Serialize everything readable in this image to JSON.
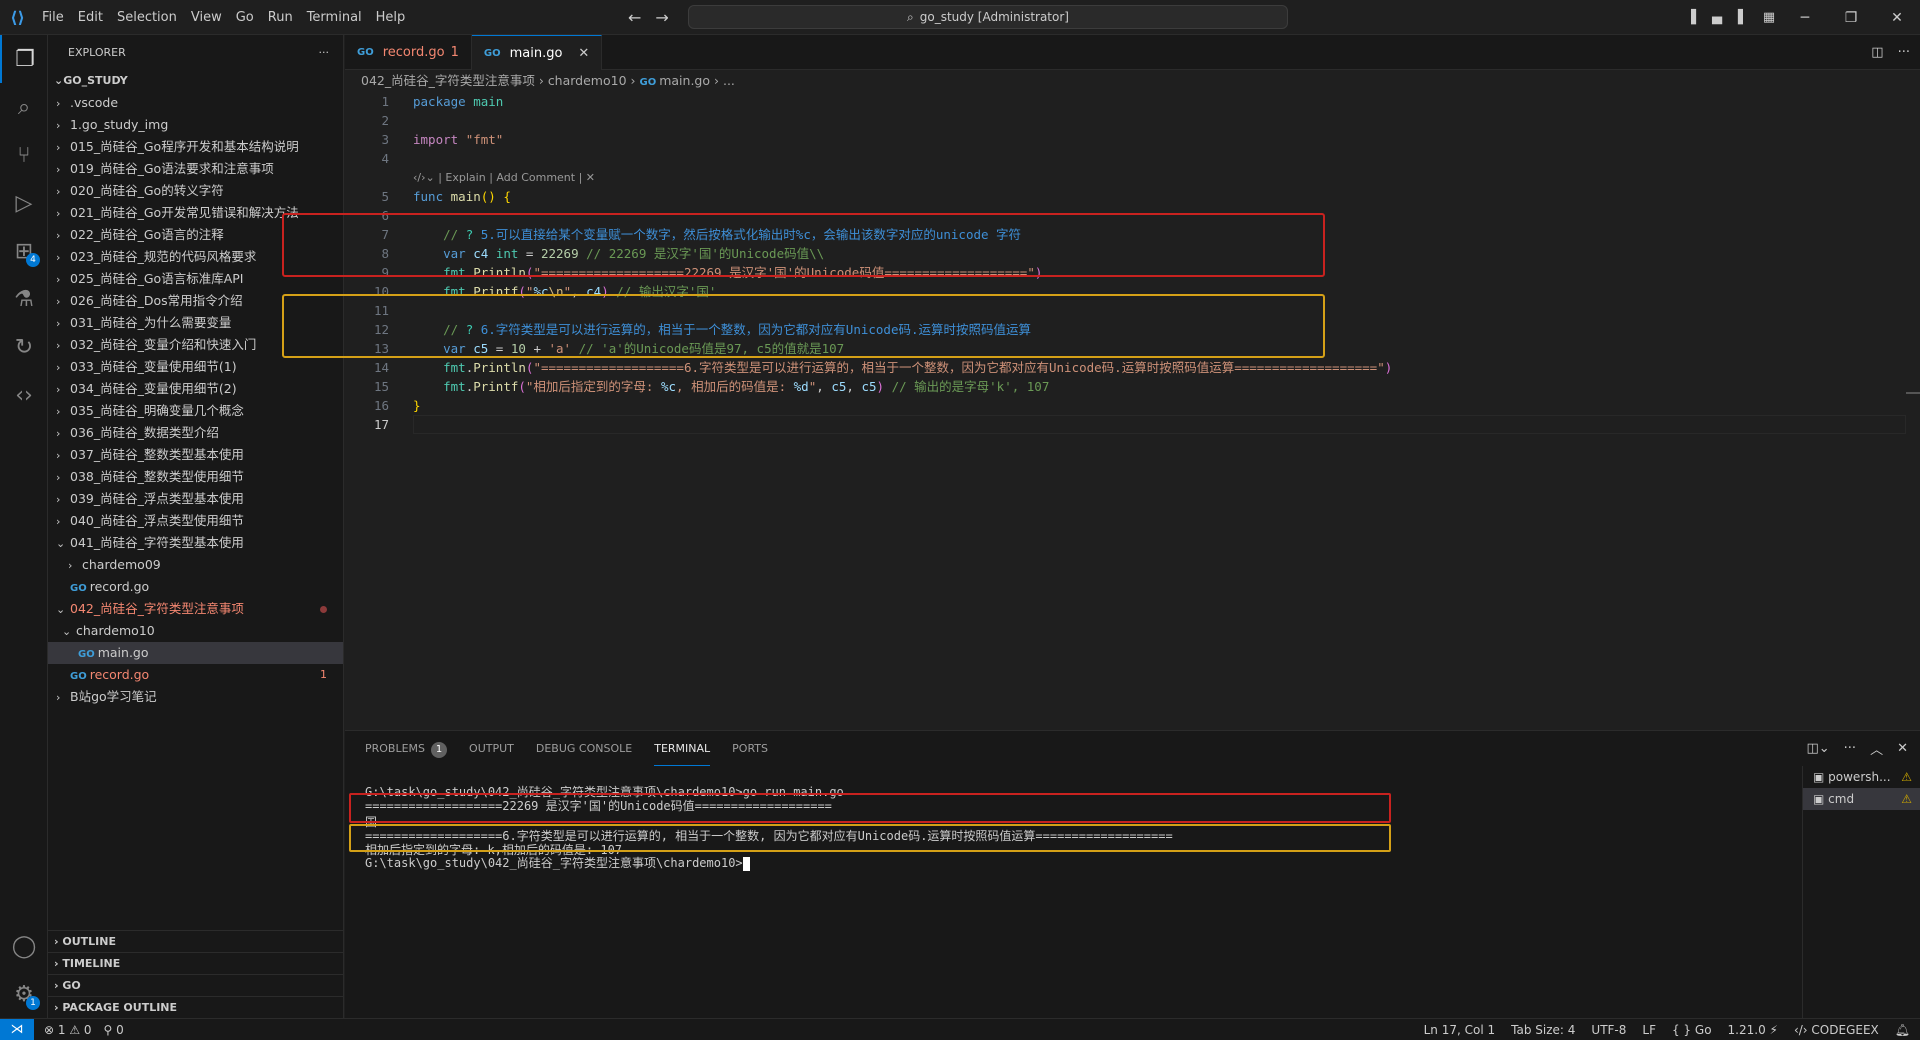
{
  "titlebar": {
    "menus": [
      "File",
      "Edit",
      "Selection",
      "View",
      "Go",
      "Run",
      "Terminal",
      "Help"
    ],
    "search_text": "go_study [Administrator]",
    "icons": [
      "toggle-sidebar-icon",
      "toggle-panel-icon",
      "toggle-secondary-sidebar-icon",
      "customize-layout-icon"
    ]
  },
  "activitybar": {
    "items": [
      "explorer-icon",
      "search-icon",
      "source-control-icon",
      "run-debug-icon",
      "extensions-icon",
      "testing-icon",
      "git-graph-icon",
      "codegeex-icon"
    ],
    "extensions_badge": "4",
    "settings_badge": "1"
  },
  "sidebar": {
    "title": "EXPLORER",
    "root": "GO_STUDY",
    "items": [
      {
        "label": ".vscode",
        "type": "folder"
      },
      {
        "label": "1.go_study_img",
        "type": "folder"
      },
      {
        "label": "015_尚硅谷_Go程序开发和基本结构说明",
        "type": "folder"
      },
      {
        "label": "019_尚硅谷_Go语法要求和注意事项",
        "type": "folder"
      },
      {
        "label": "020_尚硅谷_Go的转义字符",
        "type": "folder"
      },
      {
        "label": "021_尚硅谷_Go开发常见错误和解决方法",
        "type": "folder"
      },
      {
        "label": "022_尚硅谷_Go语言的注释",
        "type": "folder"
      },
      {
        "label": "023_尚硅谷_规范的代码风格要求",
        "type": "folder"
      },
      {
        "label": "025_尚硅谷_Go语言标准库API",
        "type": "folder"
      },
      {
        "label": "026_尚硅谷_Dos常用指令介绍",
        "type": "folder"
      },
      {
        "label": "031_尚硅谷_为什么需要变量",
        "type": "folder"
      },
      {
        "label": "032_尚硅谷_变量介绍和快速入门",
        "type": "folder"
      },
      {
        "label": "033_尚硅谷_变量使用细节(1)",
        "type": "folder"
      },
      {
        "label": "034_尚硅谷_变量使用细节(2)",
        "type": "folder"
      },
      {
        "label": "035_尚硅谷_明确变量几个概念",
        "type": "folder"
      },
      {
        "label": "036_尚硅谷_数据类型介绍",
        "type": "folder"
      },
      {
        "label": "037_尚硅谷_整数类型基本使用",
        "type": "folder"
      },
      {
        "label": "038_尚硅谷_整数类型使用细节",
        "type": "folder"
      },
      {
        "label": "039_尚硅谷_浮点类型基本使用",
        "type": "folder"
      },
      {
        "label": "040_尚硅谷_浮点类型使用细节",
        "type": "folder"
      },
      {
        "label": "041_尚硅谷_字符类型基本使用",
        "type": "folder-open"
      }
    ],
    "sub041": {
      "chardemo09": "chardemo09",
      "record": "record.go"
    },
    "folder042": "042_尚硅谷_字符类型注意事项",
    "chardemo10": "chardemo10",
    "main_file": "main.go",
    "record_file": "record.go",
    "record_count": "1",
    "bilibili": "B站go学习笔记",
    "sections": [
      "OUTLINE",
      "TIMELINE",
      "GO",
      "PACKAGE OUTLINE"
    ]
  },
  "editor": {
    "tabs": [
      {
        "label": "record.go",
        "badge": "1"
      },
      {
        "label": "main.go"
      }
    ],
    "breadcrumb": [
      "042_尚硅谷_字符类型注意事项",
      "chardemo10",
      "main.go",
      "..."
    ],
    "codelens": "| Explain | Add Comment |",
    "line_numbers": [
      "1",
      "2",
      "3",
      "4",
      "5",
      "6",
      "7",
      "8",
      "9",
      "10",
      "11",
      "12",
      "13",
      "14",
      "15",
      "16",
      "17"
    ]
  },
  "panel": {
    "tabs": [
      "PROBLEMS",
      "OUTPUT",
      "DEBUG CONSOLE",
      "TERMINAL",
      "PORTS"
    ],
    "problems_count": "1",
    "active_tab": "TERMINAL",
    "terminal_lines": [
      "G:\\task\\go_study\\042_尚硅谷_字符类型注意事项\\chardemo10>go run main.go",
      "===================22269 是汉字'国'的Unicode码值===================",
      "国",
      "===================6.字符类型是可以进行运算的, 相当于一个整数, 因为它都对应有Unicode码.运算时按照码值运算===================",
      "相加后指定到的字母: k,相加后的码值是: 107",
      "G:\\task\\go_study\\042_尚硅谷_字符类型注意事项\\chardemo10>"
    ],
    "terminals": [
      {
        "label": "powersh...",
        "warn": "⚠"
      },
      {
        "label": "cmd",
        "warn": "⚠"
      }
    ]
  },
  "statusbar": {
    "errors": "1",
    "warnings": "0",
    "ports": "0",
    "position": "Ln 17, Col 1",
    "tab_size": "Tab Size: 4",
    "encoding": "UTF-8",
    "eol": "LF",
    "language": "Go",
    "version": "1.21.0",
    "codegeex": "CODEGEEX"
  },
  "colors": {
    "accent": "#0078d4",
    "highlight_red": "#c8221f",
    "highlight_yellow": "#d4a017",
    "modified": "#f48771"
  }
}
